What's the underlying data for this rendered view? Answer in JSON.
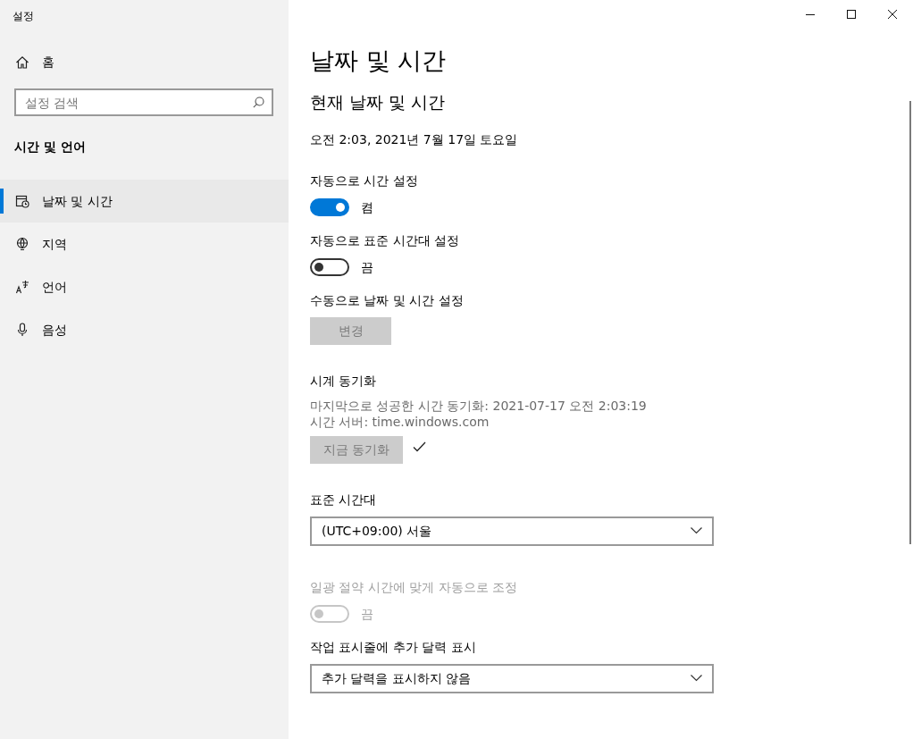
{
  "window": {
    "title": "설정"
  },
  "sidebar": {
    "home": "홈",
    "search": {
      "placeholder": "설정 검색"
    },
    "section": "시간 및 언어",
    "items": [
      {
        "label": "날짜 및 시간",
        "kind": "calendar",
        "selected": true
      },
      {
        "label": "지역",
        "kind": "globe",
        "selected": false
      },
      {
        "label": "언어",
        "kind": "language",
        "selected": false
      },
      {
        "label": "음성",
        "kind": "microphone",
        "selected": false
      }
    ]
  },
  "page": {
    "title": "날짜 및 시간",
    "subtitle": "현재 날짜 및 시간",
    "current": "오전 2:03, 2021년 7월 17일 토요일",
    "settings": [
      {
        "kind": "toggle",
        "label": "자동으로 시간 설정",
        "on": true,
        "disabled": false,
        "state_text": "켬"
      },
      {
        "kind": "toggle",
        "label": "자동으로 표준 시간대 설정",
        "on": false,
        "disabled": false,
        "state_text": "끔"
      },
      {
        "kind": "button",
        "label": "수동으로 날짜 및 시간 설정",
        "button": "변경",
        "disabled": true
      },
      {
        "kind": "sync",
        "label": "시계 동기화",
        "lines": [
          "마지막으로 성공한 시간 동기화: 2021-07-17 오전 2:03:19",
          "시간 서버: time.windows.com"
        ],
        "button": "지금 동기화",
        "disabled": true,
        "done": true
      },
      {
        "kind": "dropdown",
        "label": "표준 시간대",
        "value": "(UTC+09:00) 서울"
      },
      {
        "kind": "toggle",
        "label": "일광 절약 시간에 맞게 자동으로 조정",
        "on": false,
        "disabled": true,
        "state_text": "끔"
      },
      {
        "kind": "dropdown",
        "label": "작업 표시줄에 추가 달력 표시",
        "value": "추가 달력을 표시하지 않음"
      }
    ]
  }
}
